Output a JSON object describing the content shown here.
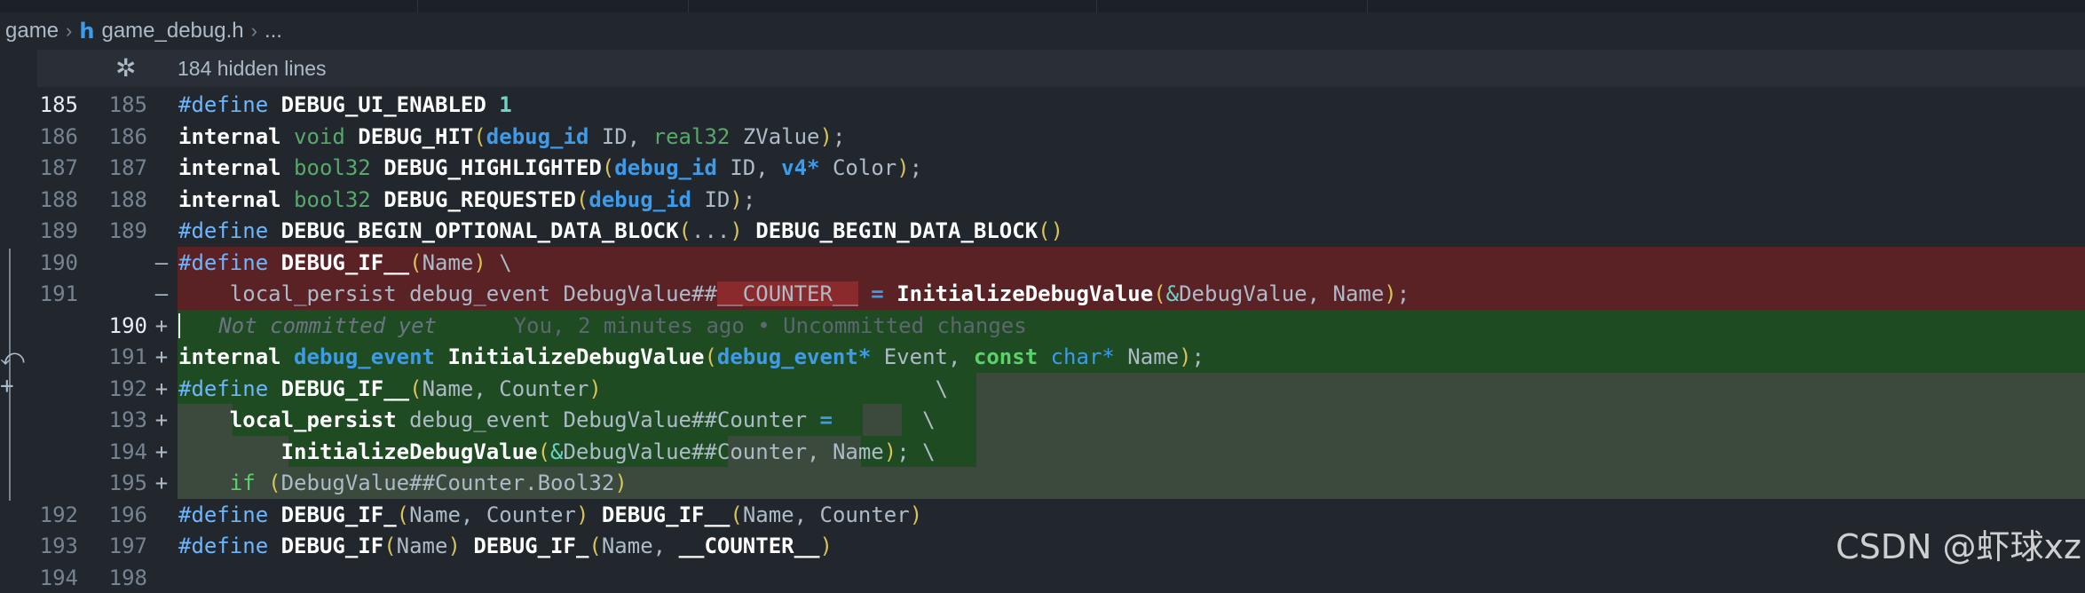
{
  "breadcrumb": {
    "folder": "game",
    "file_icon_glyph": "h",
    "file": "game_debug.h",
    "more": "..."
  },
  "hidden_lines": {
    "icon": "unfold-icon",
    "label": "184 hidden lines"
  },
  "gutter": {
    "revert_glyph": "⤺",
    "add_glyph": "+"
  },
  "lines": [
    {
      "old": "185",
      "new": "185",
      "mark": ""
    },
    {
      "old": "186",
      "new": "186",
      "mark": ""
    },
    {
      "old": "187",
      "new": "187",
      "mark": ""
    },
    {
      "old": "188",
      "new": "188",
      "mark": ""
    },
    {
      "old": "189",
      "new": "189",
      "mark": ""
    },
    {
      "old": "190",
      "new": "",
      "mark": "—"
    },
    {
      "old": "191",
      "new": "",
      "mark": "—"
    },
    {
      "old": "",
      "new": "190",
      "mark": "+"
    },
    {
      "old": "",
      "new": "191",
      "mark": "+"
    },
    {
      "old": "",
      "new": "192",
      "mark": "+"
    },
    {
      "old": "",
      "new": "193",
      "mark": "+"
    },
    {
      "old": "",
      "new": "194",
      "mark": "+"
    },
    {
      "old": "",
      "new": "195",
      "mark": "+"
    },
    {
      "old": "192",
      "new": "196",
      "mark": ""
    },
    {
      "old": "193",
      "new": "197",
      "mark": ""
    },
    {
      "old": "194",
      "new": "198",
      "mark": ""
    }
  ],
  "tok": {
    "define": "#define",
    "internal": "internal",
    "void": "void",
    "bool32": "bool32",
    "real32": "real32",
    "debug_id": "debug_id",
    "v4": "v4*",
    "debug_event": "debug_event",
    "debug_event_ptr": "debug_event*",
    "const": "const",
    "char_ptr": "char*",
    "local_persist": "local_persist",
    "if": "if",
    "m_ui_enabled": "DEBUG_UI_ENABLED",
    "one": "1",
    "f_hit": "DEBUG_HIT",
    "f_highlighted": "DEBUG_HIGHLIGHTED",
    "f_requested": "DEBUG_REQUESTED",
    "m_begin_opt": "DEBUG_BEGIN_OPTIONAL_DATA_BLOCK",
    "m_begin": "DEBUG_BEGIN_DATA_BLOCK",
    "m_if2": "DEBUG_IF__",
    "m_if1": "DEBUG_IF_",
    "m_if0": "DEBUG_IF",
    "f_init": "InitializeDebugValue",
    "ID": "ID",
    "ZValue": "ZValue",
    "Color": "Color",
    "Name": "Name",
    "Counter": "Counter",
    "Event": "Event",
    "COUNTER": "__COUNTER__",
    "dv_hash": "DebugValue##",
    "dv": "DebugValue",
    "dv_counter": "DebugValue##Counter",
    "bool32_field": ".Bool32",
    "ellipsis": "...",
    "eq": "=",
    "bs": "\\",
    "blame_author": "Not committed yet",
    "blame_detail": "You, 2 minutes ago • Uncommitted changes"
  },
  "watermark": "CSDN @虾球xz"
}
